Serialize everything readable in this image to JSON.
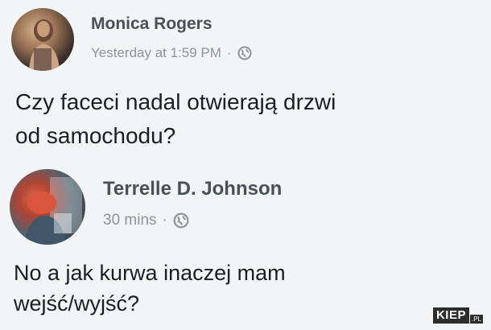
{
  "posts": [
    {
      "author": "Monica Rogers",
      "timestamp": "Yesterday at 1:59 PM",
      "separator": "·",
      "privacy_icon": "globe-icon",
      "text_lines": [
        "Czy faceci nadal otwierają drzwi",
        "od samochodu?"
      ]
    },
    {
      "author": "Terrelle D. Johnson",
      "timestamp": "30 mins",
      "separator": "·",
      "privacy_icon": "globe-icon",
      "text_lines": [
        "No a jak kurwa inaczej mam",
        "wejść/wyjść?"
      ]
    }
  ],
  "watermark": {
    "brand": "KIEP",
    "suffix": ".PL"
  }
}
